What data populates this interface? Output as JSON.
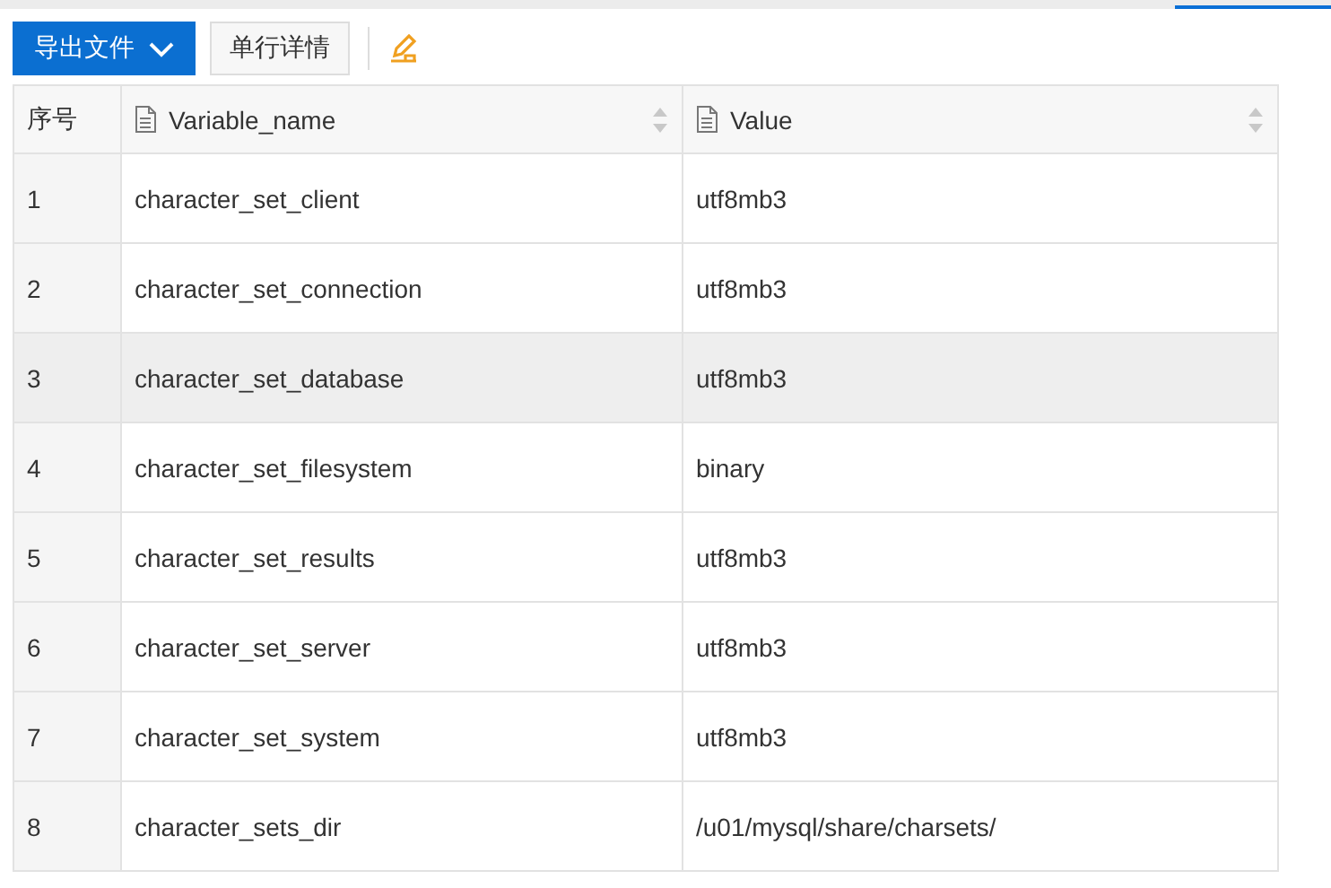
{
  "toolbar": {
    "export_button": "导出文件",
    "detail_button": "单行详情"
  },
  "table": {
    "columns": [
      "序号",
      "Variable_name",
      "Value"
    ],
    "rows": [
      {
        "index": "1",
        "name": "character_set_client",
        "value": "utf8mb3",
        "selected": false
      },
      {
        "index": "2",
        "name": "character_set_connection",
        "value": "utf8mb3",
        "selected": false
      },
      {
        "index": "3",
        "name": "character_set_database",
        "value": "utf8mb3",
        "selected": true
      },
      {
        "index": "4",
        "name": "character_set_filesystem",
        "value": "binary",
        "selected": false
      },
      {
        "index": "5",
        "name": "character_set_results",
        "value": "utf8mb3",
        "selected": false
      },
      {
        "index": "6",
        "name": "character_set_server",
        "value": "utf8mb3",
        "selected": false
      },
      {
        "index": "7",
        "name": "character_set_system",
        "value": "utf8mb3",
        "selected": false
      },
      {
        "index": "8",
        "name": "character_sets_dir",
        "value": "/u01/mysql/share/charsets/",
        "selected": false
      }
    ]
  }
}
